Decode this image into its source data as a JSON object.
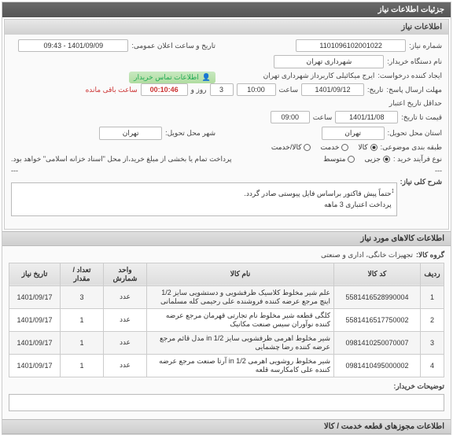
{
  "header": {
    "title": "جزئیات اطلاعات نیاز"
  },
  "need": {
    "title": "اطلاعات نیاز",
    "number_lbl": "شماره نیاز:",
    "number": "1101096102001022",
    "announce_lbl": "تاریخ و ساعت اعلان عمومی:",
    "announce": "1401/09/09 - 09:43",
    "buyer_lbl": "نام دستگاه خریدار:",
    "buyer": "شهرداری تهران",
    "creator_lbl": "ایجاد کننده درخواست:",
    "creator": "ایرج میکائیلی کاربرداز شهرداری تهران",
    "contact": "اطلاعات تماس خریدار",
    "deadline_lbl": "مهلت ارسال پاسخ:",
    "deadline_date_lbl": "تاریخ:",
    "deadline_date": "1401/09/12",
    "saat_lbl": "ساعت",
    "deadline_time": "10:00",
    "days": "3",
    "rooz_va": "روز و",
    "timer": "00:10:46",
    "remain": "ساعت باقی مانده",
    "minvalid_lbl": "حداقل تاریخ اعتبار",
    "minvalid_lbl2": "قیمت تا تاریخ:",
    "minvalid_date": "1401/11/08",
    "minvalid_time": "09:00",
    "loc_lbl": "استان محل تحویل:",
    "loc_prov": "تهران",
    "loc_city_lbl": "شهر محل تحویل:",
    "loc_city": "تهران",
    "cat_lbl": "طبقه بندی موضوعی:",
    "cat_goods": "کالا",
    "cat_service": "خدمت",
    "cat_both": "کالا/خدمت",
    "proc_lbl": "نوع فرآیند خرید :",
    "proc_partial": "جزیی",
    "proc_mid": "متوسط",
    "proc_note": "پرداخت تمام یا بخشی از مبلغ خرید،از محل \"اسناد خزانه اسلامی\" خواهد بود.",
    "dash": "---"
  },
  "desc": {
    "title": "شرح کلی نیاز:",
    "line1": "حتماً پیش فاکتور براساس فایل پیوستی صادر گردد.",
    "line2": "پرداخت اعتباری 3 ماهه",
    "arrows": "↕"
  },
  "items": {
    "title": "اطلاعات کالاهای مورد نیاز",
    "group_lbl": "گروه کالا:",
    "group_val": "تجهیزات خانگی، اداری و صنعتی",
    "cols": {
      "row": "ردیف",
      "code": "کد کالا",
      "name": "نام کالا",
      "unit": "واحد شمارش",
      "qty": "تعداد / مقدار",
      "need_date": "تاریخ نیاز"
    },
    "rows": [
      {
        "n": "1",
        "code": "5581416528990004",
        "name": "علم شیر مخلوط کلاسیک ظرفشویی و دستشویی سایز 1/2 اینچ مرجع عرضه کننده فروشنده علی رحیمی کله مسلمانی",
        "unit": "عدد",
        "qty": "3",
        "date": "1401/09/17"
      },
      {
        "n": "2",
        "code": "5581416517750002",
        "name": "کلگی قطعه شیر مخلوط نام تجارتی قهرمان مرجع عرضه کننده نوآوران سیس صنعت مکانیک",
        "unit": "عدد",
        "qty": "1",
        "date": "1401/09/17"
      },
      {
        "n": "3",
        "code": "0981410250070007",
        "name": "شیر مخلوط اهرمی ظرفشویی سایز 1/2 in مدل قائم مرجع عرضه کننده رضا چشمایی",
        "unit": "عدد",
        "qty": "1",
        "date": "1401/09/17"
      },
      {
        "n": "4",
        "code": "0981410495000002",
        "name": "شیر مخلوط روشویی اهرمی 1/2 in آرتا صنعت مرجع عرضه کننده علی کامکارسه قلعه",
        "unit": "عدد",
        "qty": "1",
        "date": "1401/09/17"
      }
    ],
    "buyer_desc_lbl": "توضیحات خریدار:"
  },
  "footer": {
    "title": "اطلاعات مجوزهای قطعه خدمت / کالا"
  }
}
